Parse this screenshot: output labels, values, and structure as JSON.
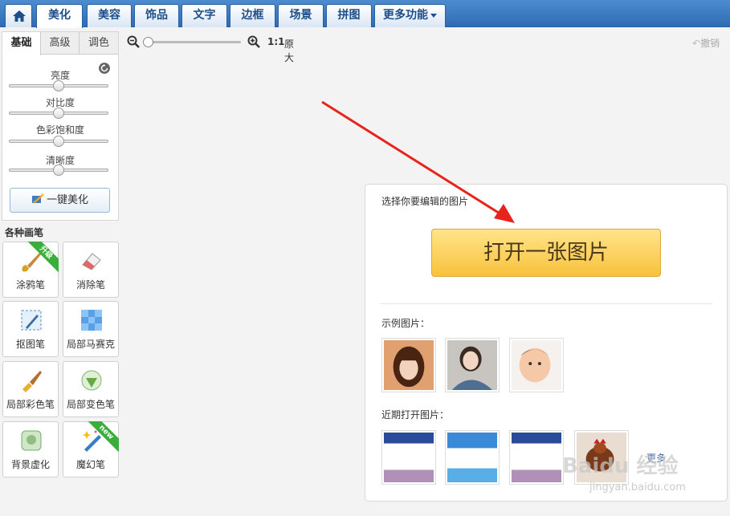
{
  "nav": {
    "home_icon": "home-icon",
    "tabs": [
      "美化",
      "美容",
      "饰品",
      "文字",
      "边框",
      "场景",
      "拼图"
    ],
    "more": "更多功能"
  },
  "subtabs": [
    "基础",
    "高级",
    "调色"
  ],
  "sliders": [
    {
      "label": "亮度",
      "value": 0.5
    },
    {
      "label": "对比度",
      "value": 0.5
    },
    {
      "label": "色彩饱和度",
      "value": 0.5
    },
    {
      "label": "清晰度",
      "value": 0.5
    }
  ],
  "onekey_label": "一键美化",
  "brush_title": "各种画笔",
  "tools": [
    {
      "label": "涂鸦笔",
      "icon": "brush-icon",
      "badge": "升级"
    },
    {
      "label": "消除笔",
      "icon": "eraser-icon",
      "badge": ""
    },
    {
      "label": "抠图笔",
      "icon": "cutout-pen-icon",
      "badge": ""
    },
    {
      "label": "局部马赛克",
      "icon": "mosaic-icon",
      "badge": ""
    },
    {
      "label": "局部彩色笔",
      "icon": "color-brush-icon",
      "badge": ""
    },
    {
      "label": "局部变色笔",
      "icon": "recolor-icon",
      "badge": ""
    },
    {
      "label": "背景虚化",
      "icon": "blur-icon",
      "badge": ""
    },
    {
      "label": "魔幻笔",
      "icon": "magic-pen-icon",
      "badge": "new"
    }
  ],
  "zoom": {
    "ratio": "1:1",
    "original": "原大",
    "level": 0.0
  },
  "undo": "撤销",
  "card": {
    "choose_label": "选择你要编辑的图片",
    "open_button": "打开一张图片",
    "examples_label": "示例图片：",
    "recent_label": "近期打开图片：",
    "more": "更多"
  },
  "watermark": {
    "brand": "Baidu 经验",
    "url": "jingyan.baidu.com"
  },
  "colors": {
    "nav": "#3a78c0",
    "accent": "#f8c23c",
    "arrow": "#e8231b"
  }
}
